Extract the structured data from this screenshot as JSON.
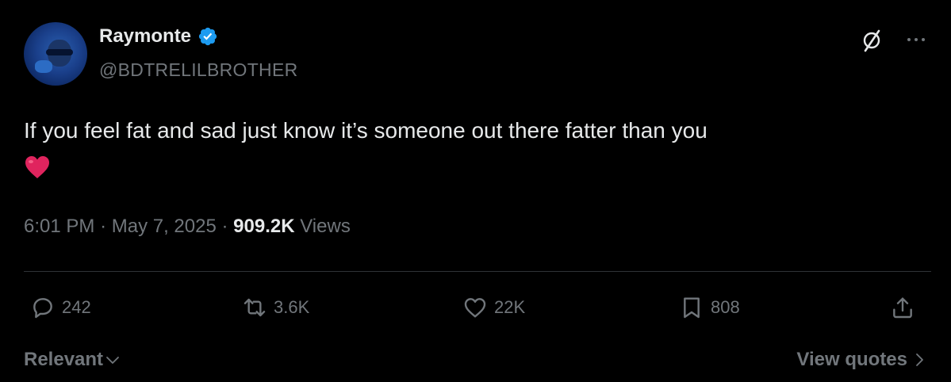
{
  "author": {
    "display_name": "Raymonte",
    "handle": "@BDTRELILBROTHER",
    "verified_color": "#1d9bf0"
  },
  "tweet": {
    "text": "If you feel fat and sad just know it’s someone out there fatter than you",
    "emoji": "red-heart"
  },
  "meta": {
    "time": "6:01 PM",
    "separator": "·",
    "date": "May 7, 2025",
    "views_count": "909.2K",
    "views_label": "Views"
  },
  "actions": {
    "replies": "242",
    "reposts": "3.6K",
    "likes": "22K",
    "bookmarks": "808"
  },
  "footer": {
    "sort_label": "Relevant",
    "view_quotes_label": "View quotes"
  },
  "icons": [
    "verified-badge-icon",
    "grok-icon",
    "more-icon",
    "reply-icon",
    "repost-icon",
    "like-icon",
    "bookmark-icon",
    "share-icon",
    "chevron-down-icon",
    "chevron-right-icon"
  ],
  "colors": {
    "background": "#000000",
    "text": "#e7e9ea",
    "secondary": "#71767b",
    "divider": "#2f3336",
    "heart": "#e0245e"
  }
}
